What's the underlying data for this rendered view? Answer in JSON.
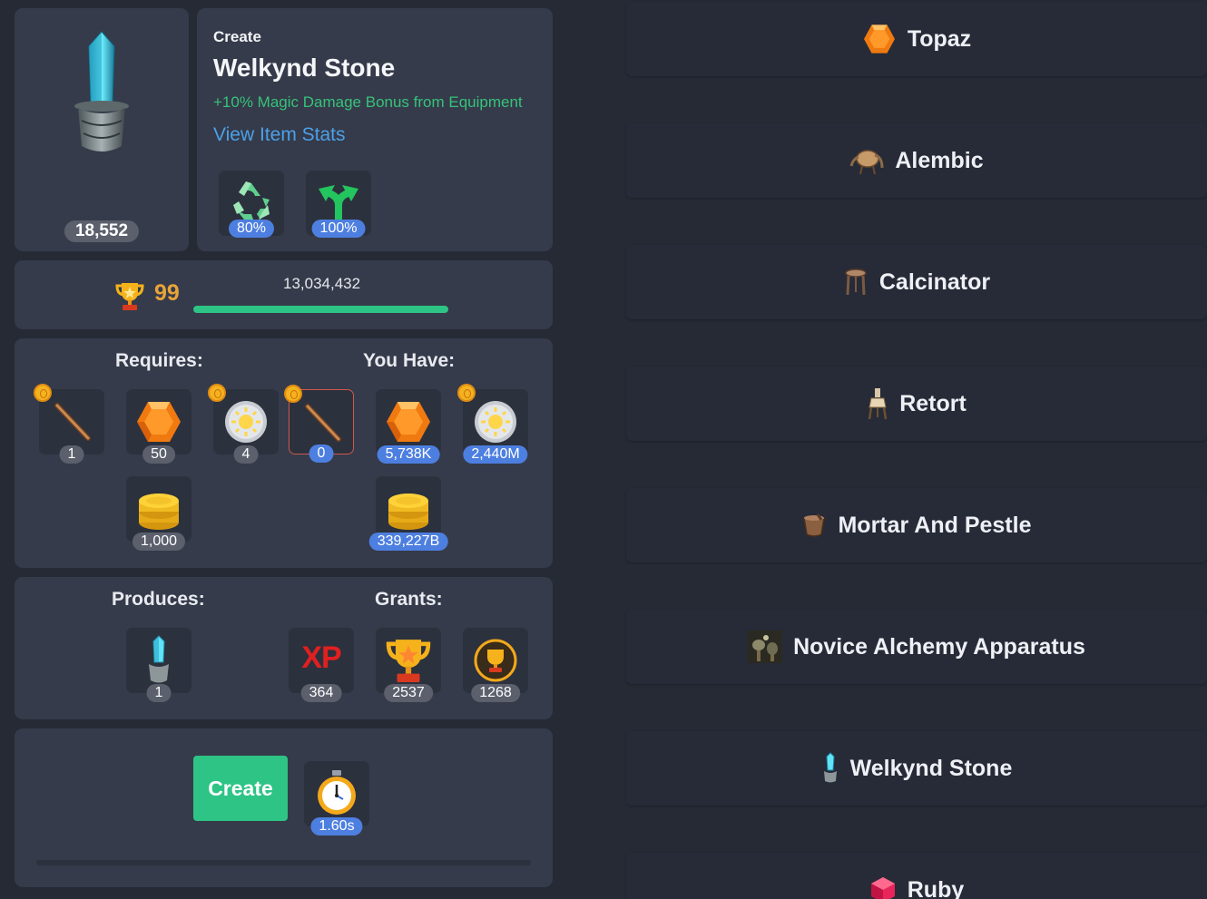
{
  "item": {
    "count": "18,552",
    "action": "Create",
    "name": "Welkynd Stone",
    "bonus": "+10% Magic Damage Bonus from Equipment",
    "stats_link": "View Item Stats",
    "preserve_pct": "80%",
    "efficiency_pct": "100%"
  },
  "progress": {
    "level": "99",
    "xp": "13,034,432",
    "fill_fraction": 1.0
  },
  "requires": {
    "title": "Requires:",
    "items": [
      {
        "icon": "wooden-stick-icon",
        "qty": "1"
      },
      {
        "icon": "topaz-icon",
        "qty": "50"
      },
      {
        "icon": "silver-sun-coin-icon",
        "qty": "4"
      },
      {
        "icon": "wooden-stick-icon",
        "qty": "0"
      }
    ],
    "gold": {
      "icon": "gold-coins-icon",
      "qty": "1,000"
    }
  },
  "have": {
    "title": "You Have:",
    "items": [
      {
        "icon": "topaz-icon",
        "qty": "5,738K"
      },
      {
        "icon": "silver-sun-coin-icon",
        "qty": "2,440M"
      }
    ],
    "gold": {
      "icon": "gold-coins-icon",
      "qty": "339,227B"
    }
  },
  "produces": {
    "title": "Produces:",
    "item": {
      "icon": "welkynd-stone-icon",
      "qty": "1"
    }
  },
  "grants": {
    "title": "Grants:",
    "xp_text": "XP",
    "items": [
      {
        "icon": "xp-icon",
        "qty": "364"
      },
      {
        "icon": "trophy-icon",
        "qty": "2537"
      },
      {
        "icon": "mastery-trophy-icon",
        "qty": "1268"
      }
    ]
  },
  "create": {
    "button": "Create",
    "time": "1.60s"
  },
  "recipes": [
    {
      "label": "Topaz",
      "icon": "topaz-icon"
    },
    {
      "label": "Alembic",
      "icon": "alembic-icon"
    },
    {
      "label": "Calcinator",
      "icon": "calcinator-icon"
    },
    {
      "label": "Retort",
      "icon": "retort-icon"
    },
    {
      "label": "Mortar And Pestle",
      "icon": "mortar-icon"
    },
    {
      "label": "Novice Alchemy Apparatus",
      "icon": "apparatus-icon"
    },
    {
      "label": "Welkynd Stone",
      "icon": "welkynd-stone-icon"
    },
    {
      "label": "Ruby",
      "icon": "ruby-icon"
    }
  ],
  "colors": {
    "panel": "#353b4a",
    "background": "#252a35",
    "accent_green": "#2ec486",
    "link_blue": "#4ca0e8",
    "bonus_green": "#36c27a",
    "level_gold": "#e8a33a"
  }
}
